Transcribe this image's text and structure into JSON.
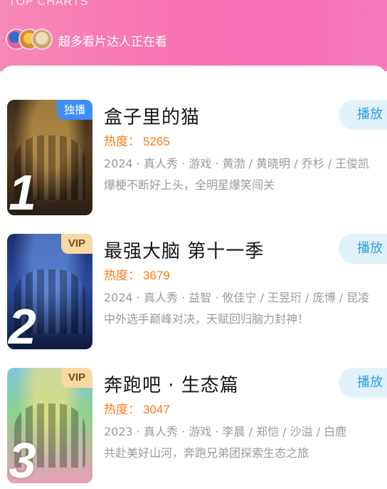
{
  "header": {
    "title": "TOP CHARTS",
    "watching_text": "超多看片达人正在看"
  },
  "items": [
    {
      "rank": "1",
      "badge": "独播",
      "title": "盒子里的猫",
      "heat_label": "热度：",
      "heat_value": "5265",
      "meta": "2024 · 真人秀 · 游戏 · 黄渤 / 黄晓明 / 乔杉 / 王俊凯",
      "description": "爆梗不断好上头，全明星爆笑闯关",
      "play_label": "播放"
    },
    {
      "rank": "2",
      "badge": "VIP",
      "title": "最强大脑 第十一季",
      "heat_label": "热度：",
      "heat_value": "3679",
      "meta": "2024 · 真人秀 · 益智 · 攸佳宁 / 王昱珩 / 庞博 / 昆凌",
      "description": "中外选手巅峰对决，天赋回归脑力封神！",
      "play_label": "播放"
    },
    {
      "rank": "3",
      "badge": "VIP",
      "title": "奔跑吧 · 生态篇",
      "heat_label": "热度：",
      "heat_value": "3047",
      "meta": "2023 · 真人秀 · 游戏 · 李晨 / 郑恺 / 沙溢 / 白鹿",
      "description": "共赴美好山河，奔跑兄弟团探索生态之旅",
      "play_label": "播放"
    }
  ],
  "colors": {
    "header_gradient": [
      "#f789b6",
      "#f86fb6"
    ],
    "heat": "#ff7a1a",
    "play_bg": "#e2f2fb",
    "play_text": "#2a9ee0",
    "exclusive_badge": "#3d8ef7",
    "vip_badge": "#f7d9a4"
  }
}
